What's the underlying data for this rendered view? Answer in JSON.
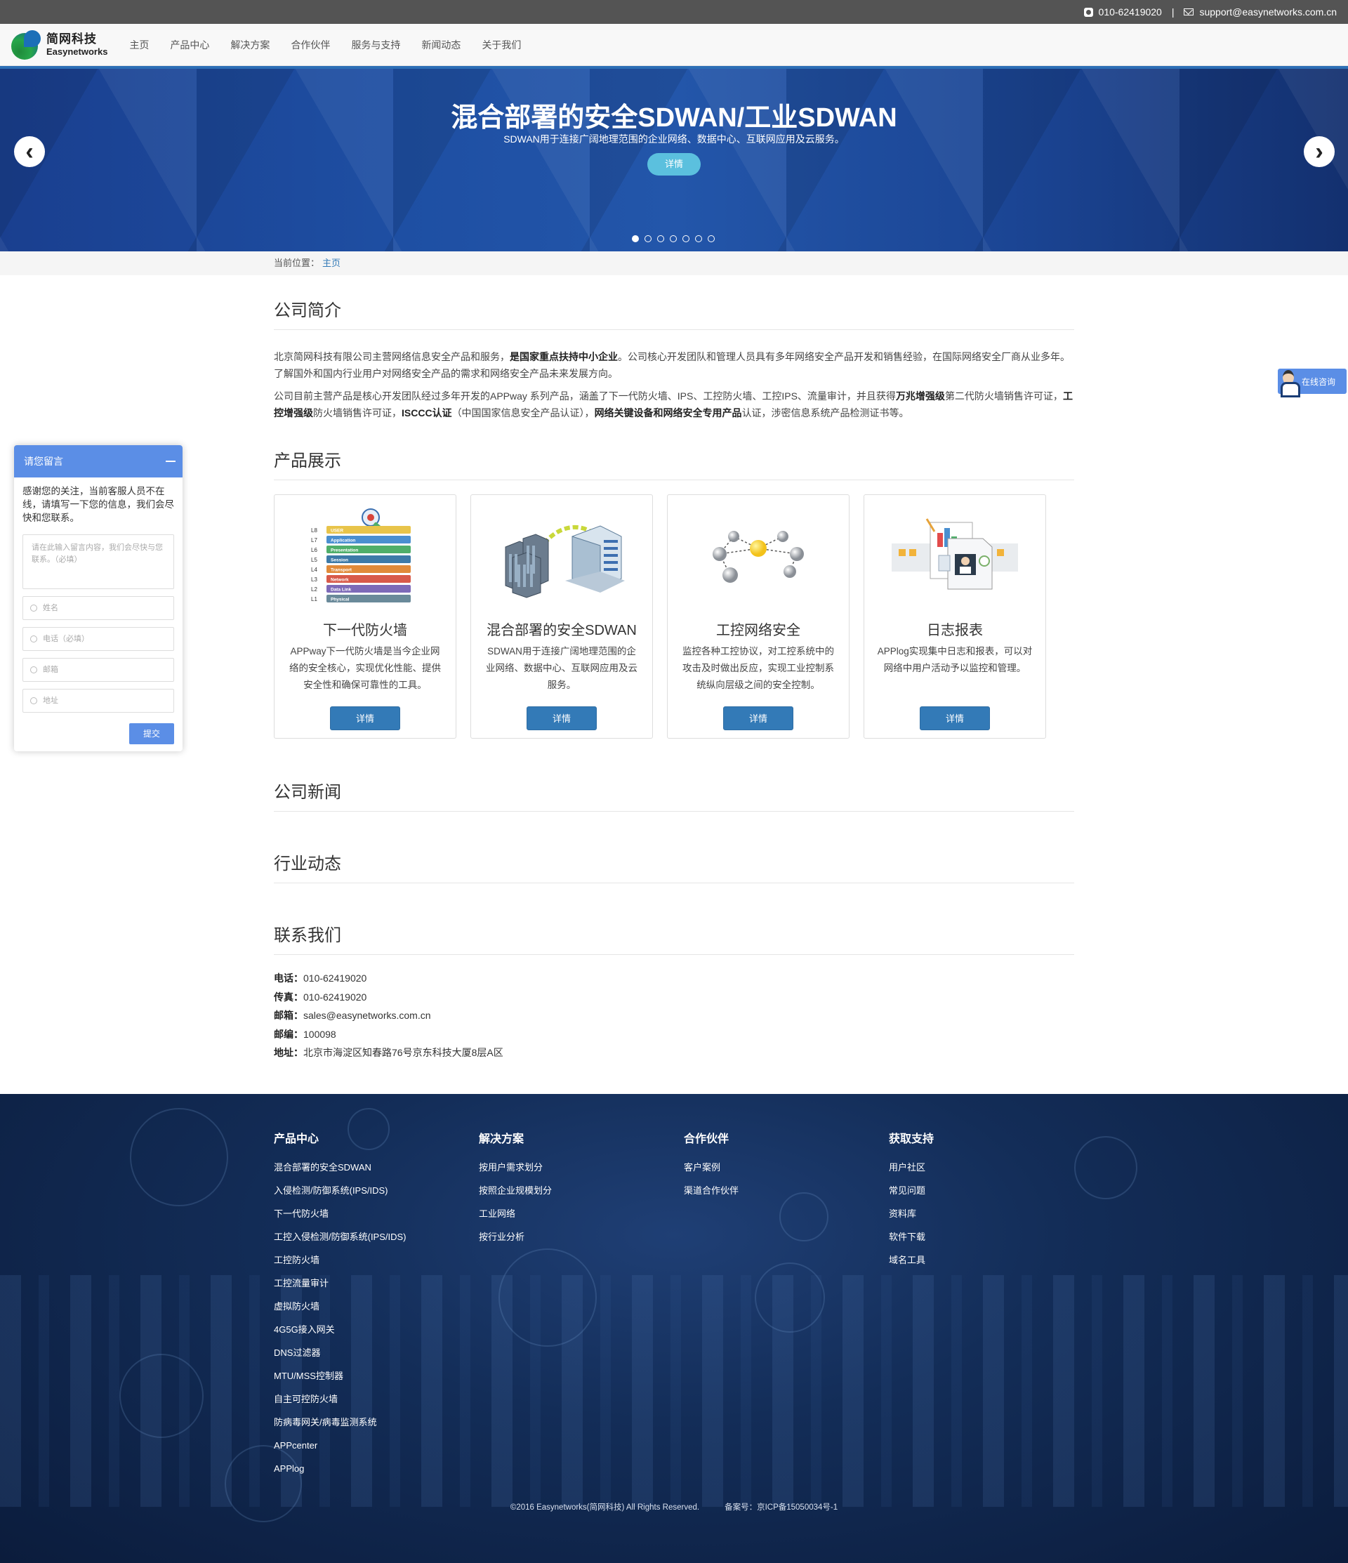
{
  "topbar": {
    "phone": "010-62419020",
    "separator": "|",
    "email": "support@easynetworks.com.cn"
  },
  "brand": {
    "name_cn": "简网科技",
    "name_en": "Easynetworks"
  },
  "nav": {
    "items": [
      "主页",
      "产品中心",
      "解决方案",
      "合作伙伴",
      "服务与支持",
      "新闻动态",
      "关于我们"
    ]
  },
  "banner": {
    "title": "混合部署的安全SDWAN/工业SDWAN",
    "subtitle": "SDWAN用于连接广阔地理范围的企业网络、数据中心、互联网应用及云服务。",
    "button": "详情",
    "prev_icon": "chevron-left-icon",
    "next_icon": "chevron-right-icon",
    "slide_count": 7,
    "active_slide": 1
  },
  "breadcrumb": {
    "label": "当前位置：",
    "current": "主页"
  },
  "intro": {
    "title": "公司简介",
    "p1_a": "北京简网科技有限公司主营网络信息安全产品和服务，",
    "p1_b": "是国家重点扶持中小企业",
    "p1_c": "。公司核心开发团队和管理人员具有多年网络安全产品开发和销售经验，在国际网络安全厂商从业多年。了解国外和国内行业用户对网络安全产品的需求和网络安全产品未来发展方向。",
    "p2_a": "公司目前主营产品是核心开发团队经过多年开发的APPway 系列产品，涵盖了下一代防火墙、IPS、工控防火墙、工控IPS、流量审计，并且获得",
    "p2_b": "万兆增强级",
    "p2_c": "第二代防火墙销售许可证，",
    "p2_d": "工控增强级",
    "p2_e": "防火墙销售许可证，",
    "p2_f": "ISCCC认证",
    "p2_g": "（中国国家信息安全产品认证），",
    "p2_h": "网络关键设备和网络安全专用产品",
    "p2_i": "认证，涉密信息系统产品检测证书等。"
  },
  "products": {
    "title": "产品展示",
    "items": [
      {
        "name": "下一代防火墙",
        "desc": "APPway下一代防火墙是当今企业网络的安全核心，实现优化性能、提供安全性和确保可靠性的工具。",
        "button": "详情",
        "icon": "osi-layers-icon"
      },
      {
        "name": "混合部署的安全SDWAN",
        "desc": "SDWAN用于连接广阔地理范围的企业网络、数据中心、互联网应用及云服务。",
        "button": "详情",
        "icon": "buildings-network-icon"
      },
      {
        "name": "工控网络安全",
        "desc": "监控各种工控协议，对工控系统中的攻击及时做出反应，实现工业控制系统纵向层级之间的安全控制。",
        "button": "详情",
        "icon": "network-nodes-icon"
      },
      {
        "name": "日志报表",
        "desc": "APPlog实现集中日志和报表，可以对网络中用户活动予以监控和管理。",
        "button": "详情",
        "icon": "report-documents-icon"
      }
    ],
    "osi_layers": [
      {
        "num": "L8",
        "label": "USER",
        "color": "#e8c44a"
      },
      {
        "num": "L7",
        "label": "Application",
        "color": "#4a8fd0"
      },
      {
        "num": "L6",
        "label": "Presentation",
        "color": "#4fae6a"
      },
      {
        "num": "L5",
        "label": "Session",
        "color": "#3d7aa8"
      },
      {
        "num": "L4",
        "label": "Transport",
        "color": "#e08a3a"
      },
      {
        "num": "L3",
        "label": "Network",
        "color": "#d85a4a"
      },
      {
        "num": "L2",
        "label": "Data Link",
        "color": "#7d6ab8"
      },
      {
        "num": "L1",
        "label": "Physical",
        "color": "#6a8a9a"
      }
    ]
  },
  "news": {
    "title": "公司新闻"
  },
  "industry": {
    "title": "行业动态"
  },
  "contact": {
    "title": "联系我们",
    "items": [
      {
        "label": "电话：",
        "value": "010-62419020"
      },
      {
        "label": "传真：",
        "value": "010-62419020"
      },
      {
        "label": "邮箱：",
        "value": "sales@easynetworks.com.cn"
      },
      {
        "label": "邮编：",
        "value": "100098"
      },
      {
        "label": "地址：",
        "value": "北京市海淀区知春路76号京东科技大厦8层A区"
      }
    ]
  },
  "footer": {
    "columns": [
      {
        "title": "产品中心",
        "links": [
          "混合部署的安全SDWAN",
          "入侵检测/防御系统(IPS/IDS)",
          "下一代防火墙",
          "工控入侵检测/防御系统(IPS/IDS)",
          "工控防火墙",
          "工控流量审计",
          "虚拟防火墙",
          "4G5G接入网关",
          "DNS过滤器",
          "MTU/MSS控制器",
          "自主可控防火墙",
          "防病毒网关/病毒监测系统",
          "APPcenter",
          "APPlog"
        ]
      },
      {
        "title": "解决方案",
        "links": [
          "按用户需求划分",
          "按照企业规模划分",
          "工业网络",
          "按行业分析"
        ]
      },
      {
        "title": "合作伙伴",
        "links": [
          "客户案例",
          "渠道合作伙伴"
        ]
      },
      {
        "title": "获取支持",
        "links": [
          "用户社区",
          "常见问题",
          "资料库",
          "软件下载",
          "域名工具"
        ]
      }
    ],
    "copyright": "©2016  Easynetworks(简网科技) All Rights Reserved.",
    "icp": "备案号：京ICP备15050034号-1"
  },
  "message_widget": {
    "title": "请您留言",
    "intro": "感谢您的关注，当前客服人员不在线，请填写一下您的信息，我们会尽快和您联系。",
    "textarea_placeholder": "请在此输入留言内容，我们会尽快与您联系。（必填）",
    "fields": [
      "姓名",
      "电话（必填）",
      "邮箱",
      "地址"
    ],
    "submit": "提交"
  },
  "online_chat": {
    "label": "在线咨询"
  },
  "colors": {
    "primary_blue": "#337ab7",
    "widget_blue": "#5b8ee6",
    "banner_button": "#5bc0de",
    "topbar": "#545454"
  }
}
